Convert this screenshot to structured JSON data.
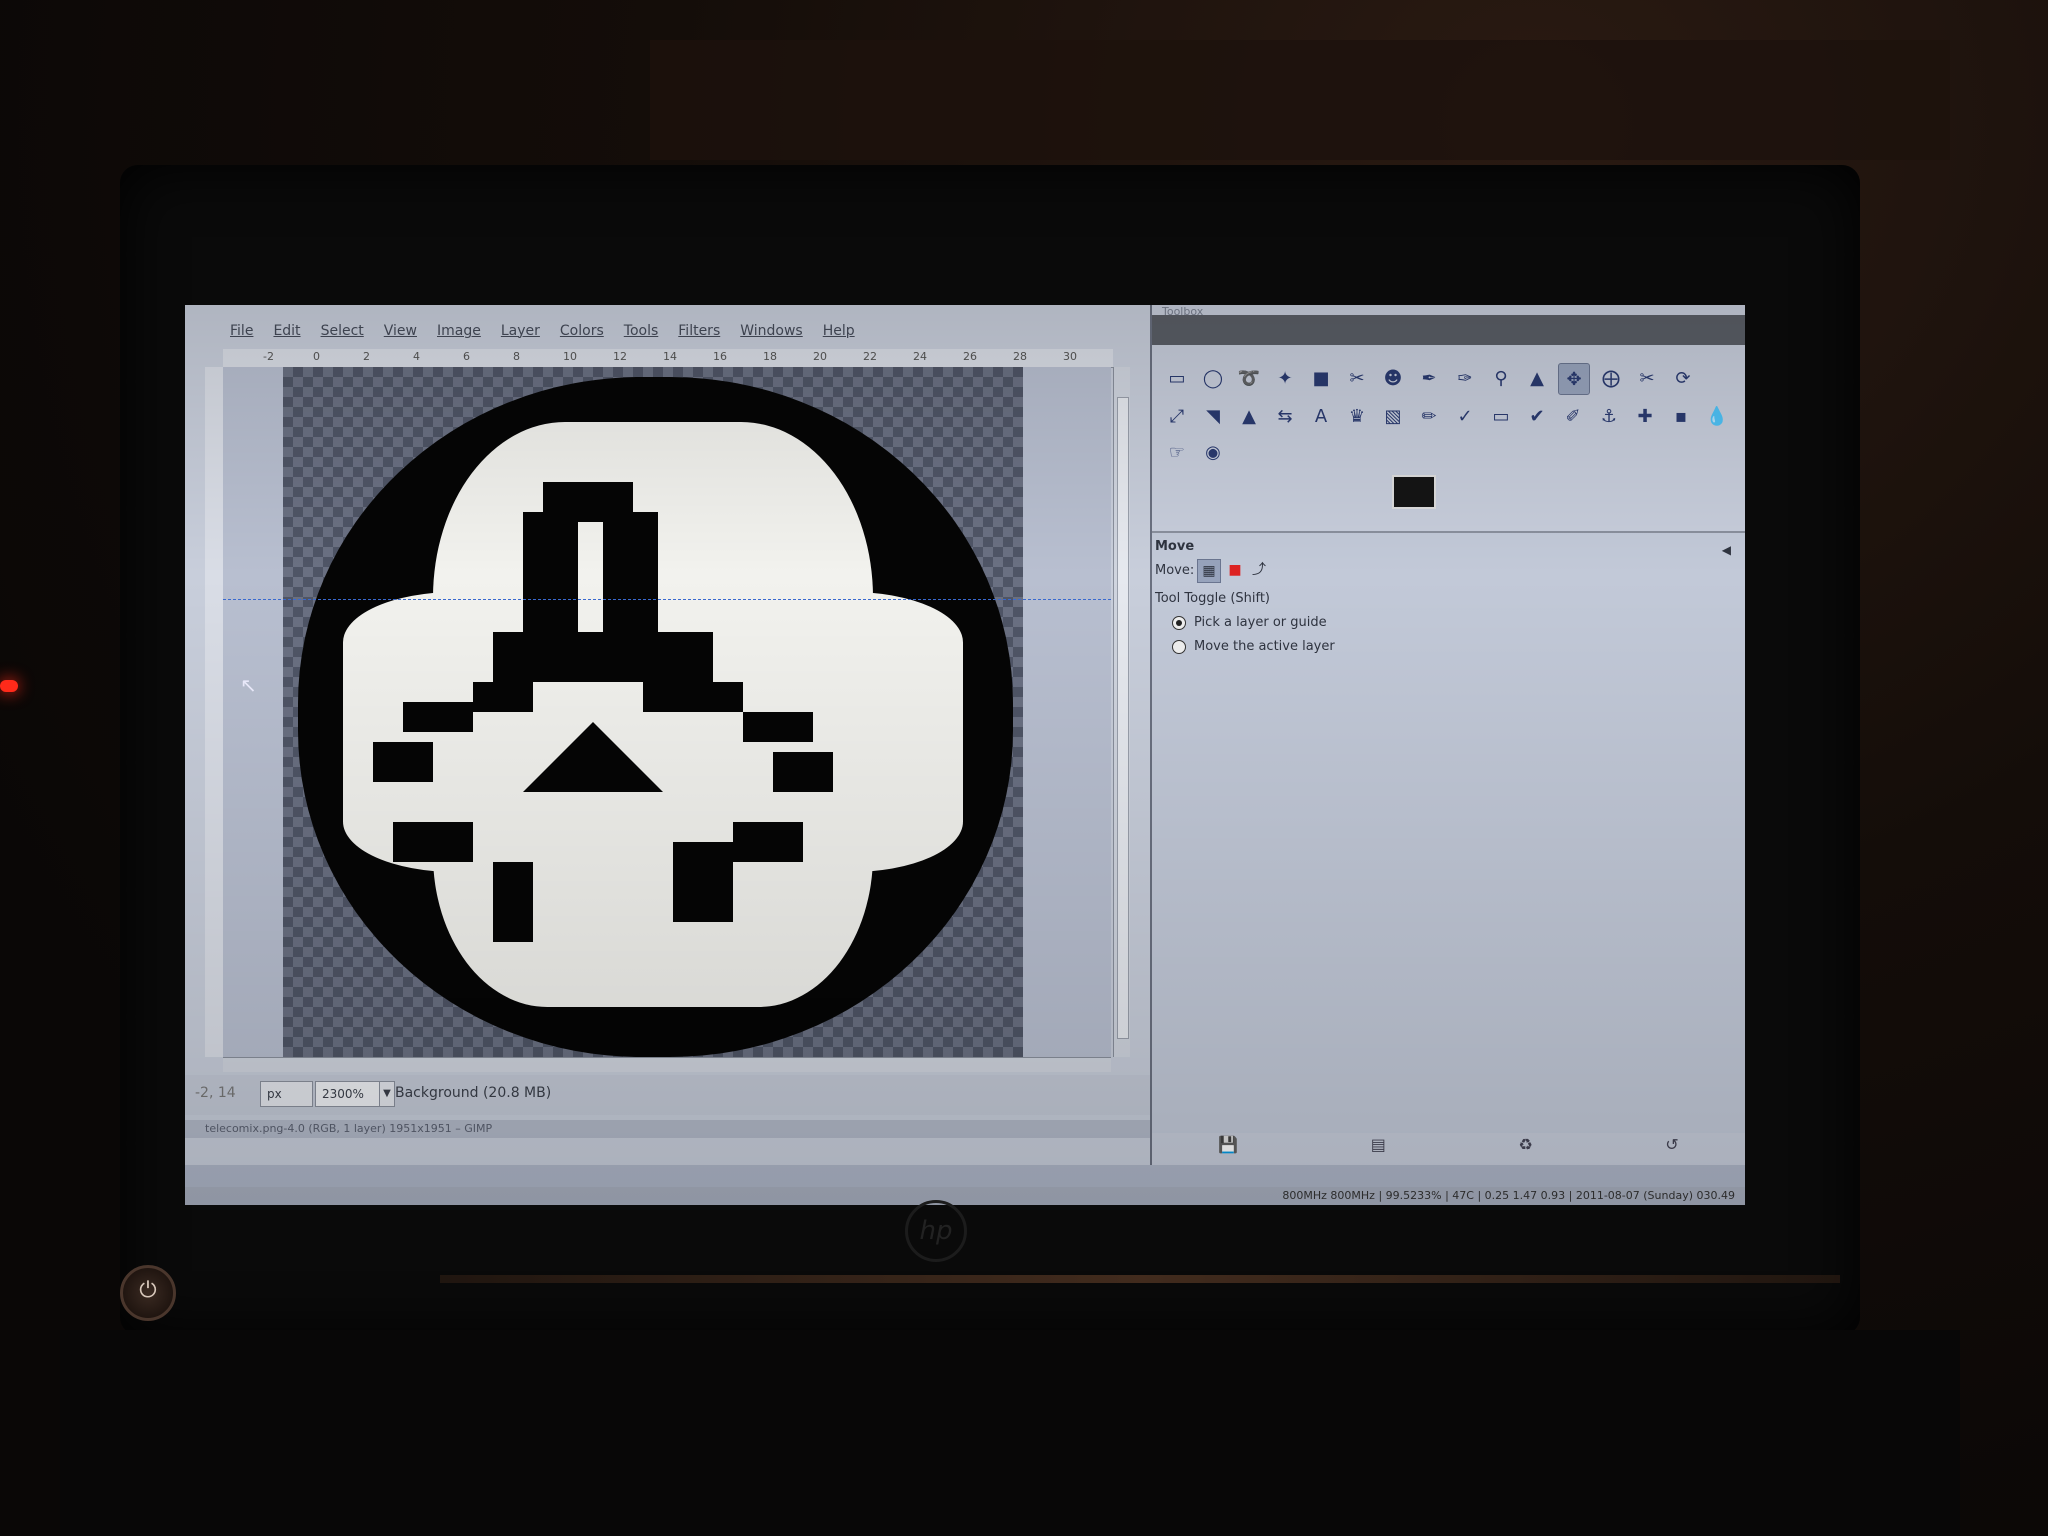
{
  "menu": [
    "File",
    "Edit",
    "Select",
    "View",
    "Image",
    "Layer",
    "Colors",
    "Tools",
    "Filters",
    "Windows",
    "Help"
  ],
  "ruler": [
    "-2",
    "0",
    "2",
    "4",
    "6",
    "8",
    "10",
    "12",
    "14",
    "16",
    "18",
    "20",
    "22",
    "24",
    "26",
    "28",
    "30"
  ],
  "status": {
    "coords": "-2, 14",
    "unit": "px",
    "zoom": "2300%",
    "layer": "Background (20.8 MB)"
  },
  "window_title": "telecomix.png-4.0 (RGB, 1 layer) 1951x1951 – GIMP",
  "toolbox": {
    "title": "Toolbox",
    "options_title": "Move",
    "move_label": "Move:",
    "toggle_label": "Tool Toggle  (Shift)",
    "radio1": "Pick a layer or guide",
    "radio2": "Move the active layer"
  },
  "sysbar": {
    "tray": "800MHz 800MHz | 99.5233% | 47C | 0.25 1.47 0.93 | 2011-08-07 (Sunday) 030.49"
  },
  "tools": [
    "rect-select-icon",
    "ellipse-select-icon",
    "lasso-icon",
    "fuzzy-select-icon",
    "color-select-icon",
    "scissors-icon",
    "foreground-select-icon",
    "paths-icon",
    "color-picker-icon",
    "zoom-icon",
    "measure-icon",
    "move-icon",
    "align-icon",
    "crop-icon",
    "rotate-icon",
    "scale-icon",
    "shear-icon",
    "perspective-icon",
    "flip-icon",
    "text-icon",
    "bucket-fill-icon",
    "blend-icon",
    "pencil-icon",
    "paintbrush-icon",
    "eraser-icon",
    "airbrush-icon",
    "ink-icon",
    "clone-icon",
    "heal-icon",
    "perspective-clone-icon",
    "blur-icon",
    "smudge-icon",
    "dodge-icon"
  ],
  "colors": {
    "fg": "#151515",
    "bg": "#eeeeee"
  }
}
